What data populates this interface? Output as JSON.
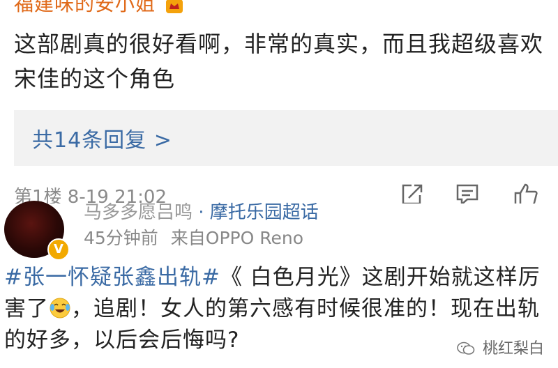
{
  "comment": {
    "author": "福建味的安小姐",
    "text": "这部剧真的很好看啊，非常的真实，而且我超级喜欢宋佳的这个角色",
    "replies_link": "共14条回复 >",
    "floor_meta": "第1楼 8-19 21:02",
    "actions": [
      "share-icon",
      "reply-icon",
      "like-icon"
    ]
  },
  "post": {
    "author_cut": "马多多愿吕鸣",
    "author_cut_blue": "· 摩托乐园超话",
    "time": "45分钟前",
    "source": "来自OPPO Reno",
    "verified_badge": "V",
    "hashtag": "#张一怀疑张鑫出轨#",
    "text1": "《 白色月光》这剧开始就这样厉害了",
    "text2": "，追剧！女人的第六感有时候很准的！现在出轨的好多，以后会后悔吗?",
    "emoji": "laughing-tears-emoji"
  },
  "watermark": "桃红梨白",
  "colors": {
    "link": "#3a6aa4",
    "name_orange": "#e06a1a",
    "badge": "#f2a900",
    "gray": "#8a8a8a"
  }
}
